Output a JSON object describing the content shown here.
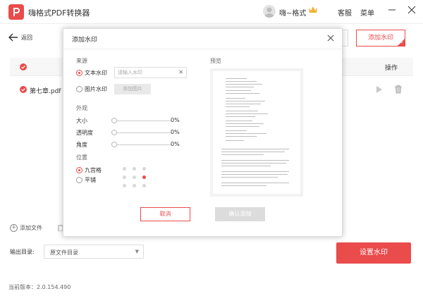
{
  "app": {
    "title": "嗨格式PDF转换器",
    "user_name": "嗨~格式",
    "support_label": "客服",
    "menu_label": "菜单"
  },
  "main": {
    "back_label": "返回",
    "add_watermark_label": "添加水印",
    "table_header_op": "操作",
    "files": [
      {
        "name": "第七章.pdf"
      }
    ],
    "add_file_label": "添加文件",
    "output_dir_label": "输出目录:",
    "output_dir_value": "原文件目录",
    "set_watermark_label": "设置水印",
    "version": "当前版本：2.0.154.490"
  },
  "modal": {
    "title": "添加水印",
    "source_label": "来源",
    "text_watermark_label": "文本水印",
    "text_input_placeholder": "请输入水印",
    "image_watermark_label": "图片水印",
    "add_image_label": "添加图片",
    "appearance_label": "外观",
    "sliders": [
      {
        "label": "大小",
        "value": "0%"
      },
      {
        "label": "透明度",
        "value": "0%"
      },
      {
        "label": "角度",
        "value": "0%"
      }
    ],
    "position_label": "位置",
    "grid_label": "九宫格",
    "tile_label": "平铺",
    "grid_selected_index": 5,
    "preview_label": "预览",
    "cancel_label": "取消",
    "confirm_label": "确认添加"
  },
  "colors": {
    "accent": "#ea4b4b",
    "disabled": "#dcdcdc"
  }
}
